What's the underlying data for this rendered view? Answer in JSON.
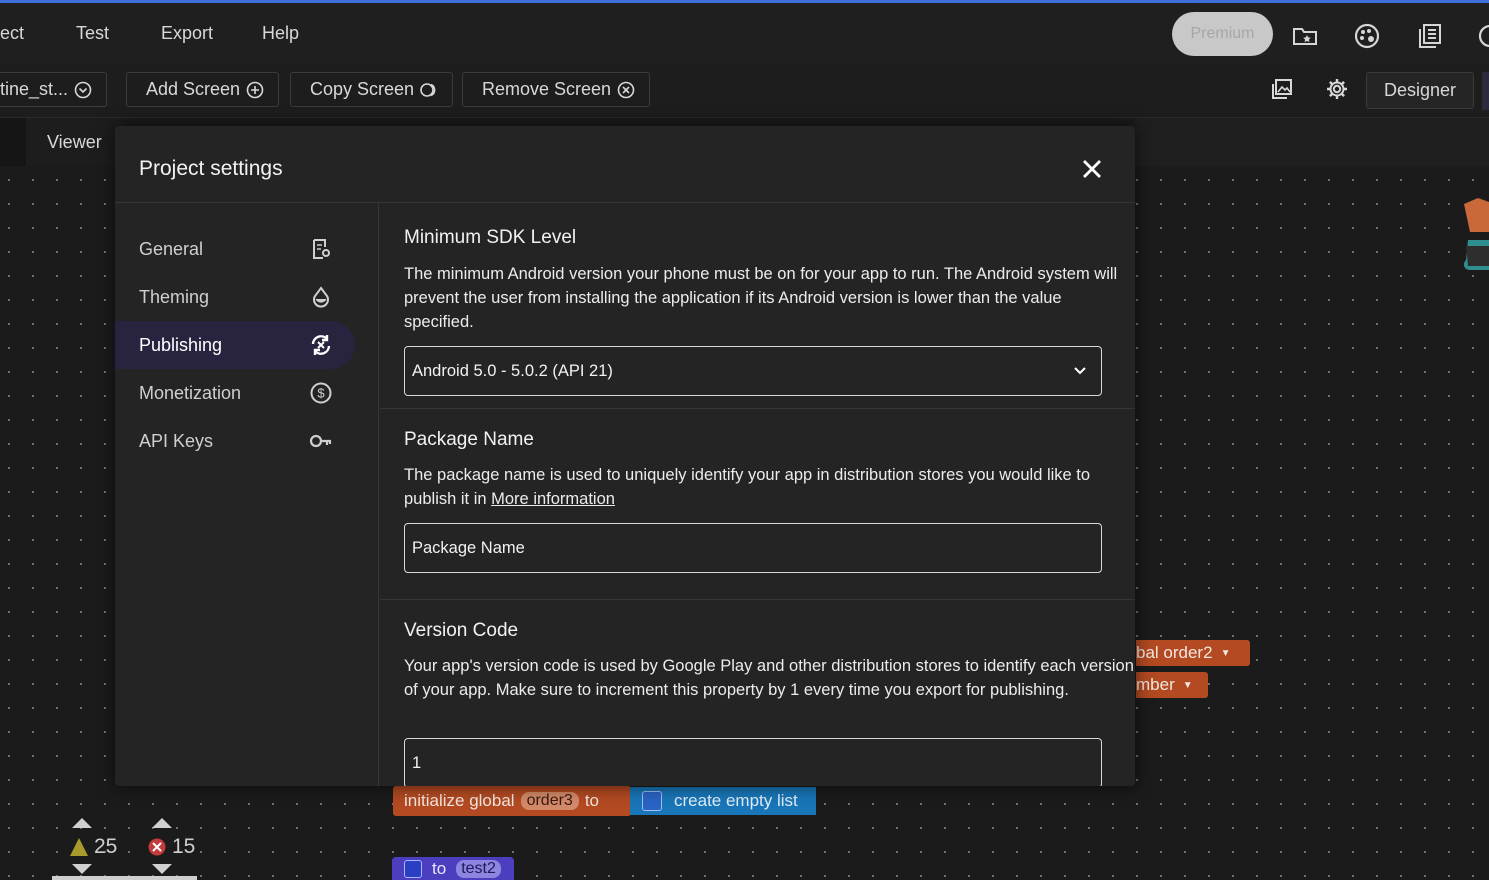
{
  "menu": {
    "items": [
      "ect",
      "Test",
      "Export",
      "Help"
    ],
    "premium_label": "Premium"
  },
  "toolbar": {
    "screen_selector": "tine_st...",
    "add_screen": "Add Screen",
    "copy_screen": "Copy Screen",
    "remove_screen": "Remove Screen",
    "designer": "Designer"
  },
  "viewer": {
    "tab_label": "Viewer"
  },
  "modal": {
    "title": "Project settings",
    "sidebar": [
      {
        "label": "General",
        "icon": "settings-document-icon",
        "active": false
      },
      {
        "label": "Theming",
        "icon": "droplet-icon",
        "active": false
      },
      {
        "label": "Publishing",
        "icon": "sync-icon",
        "active": true
      },
      {
        "label": "Monetization",
        "icon": "dollar-circle-icon",
        "active": false
      },
      {
        "label": "API Keys",
        "icon": "key-icon",
        "active": false
      }
    ],
    "sdk": {
      "title": "Minimum SDK Level",
      "description": "The minimum Android version your phone must be on for your app to run. The Android system will prevent the user from installing the application if its Android version is lower than the value specified.",
      "value": "Android 5.0 - 5.0.2 (API 21)"
    },
    "package": {
      "title": "Package Name",
      "description": "The package name is used to uniquely identify your app in distribution stores you would like to publish it in ",
      "link": "More information",
      "placeholder": "Package Name"
    },
    "version": {
      "title": "Version Code",
      "description": "Your app's version code is used by Google Play and other distribution stores to identify each version of your app. Make sure to increment this property by 1 every time you export for publishing.",
      "value": "1"
    }
  },
  "blocks": {
    "init_prefix": "initialize global",
    "init_var": "order3",
    "init_to": "to",
    "create_list": "create empty list",
    "global2": "bal order2",
    "number": "mber",
    "test2_to": "to",
    "test2_var": "test2"
  },
  "status": {
    "warnings": "25",
    "errors": "15"
  },
  "colors": {
    "accent": "#3f6fd8",
    "active_bg": "#28233f",
    "block_orange": "#b34a22",
    "block_blue": "#1976b8",
    "block_purple": "#4b3fbf"
  }
}
